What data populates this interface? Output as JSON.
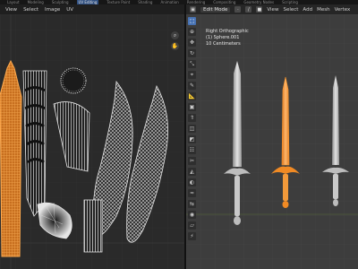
{
  "topbar": {
    "tabs": [
      "Layout",
      "Modeling",
      "Sculpting",
      "UV Editing",
      "Texture Paint",
      "Shading",
      "Animation",
      "Rendering",
      "Compositing",
      "Geometry Nodes",
      "Scripting"
    ],
    "active_index": 3
  },
  "uv_editor": {
    "menu": [
      "View",
      "Select",
      "Image",
      "UV"
    ]
  },
  "viewport": {
    "mode": "Edit Mode",
    "menu": [
      "View",
      "Select",
      "Add",
      "Mesh",
      "Vertex"
    ],
    "info": {
      "view": "Right Orthographic",
      "object": "(1) Sphere.001",
      "units": "10 Centimeters"
    }
  },
  "icons": {
    "zoom": "magnifier-icon",
    "pan": "hand-icon"
  },
  "colors": {
    "orange_selection": "#f08a24",
    "wire": "#e6e6e6",
    "viewport_bg": "#3d3d3d",
    "uv_bg": "#2a2a2a",
    "active_tab": "#2f4f80",
    "active_tool": "#4772b3"
  }
}
